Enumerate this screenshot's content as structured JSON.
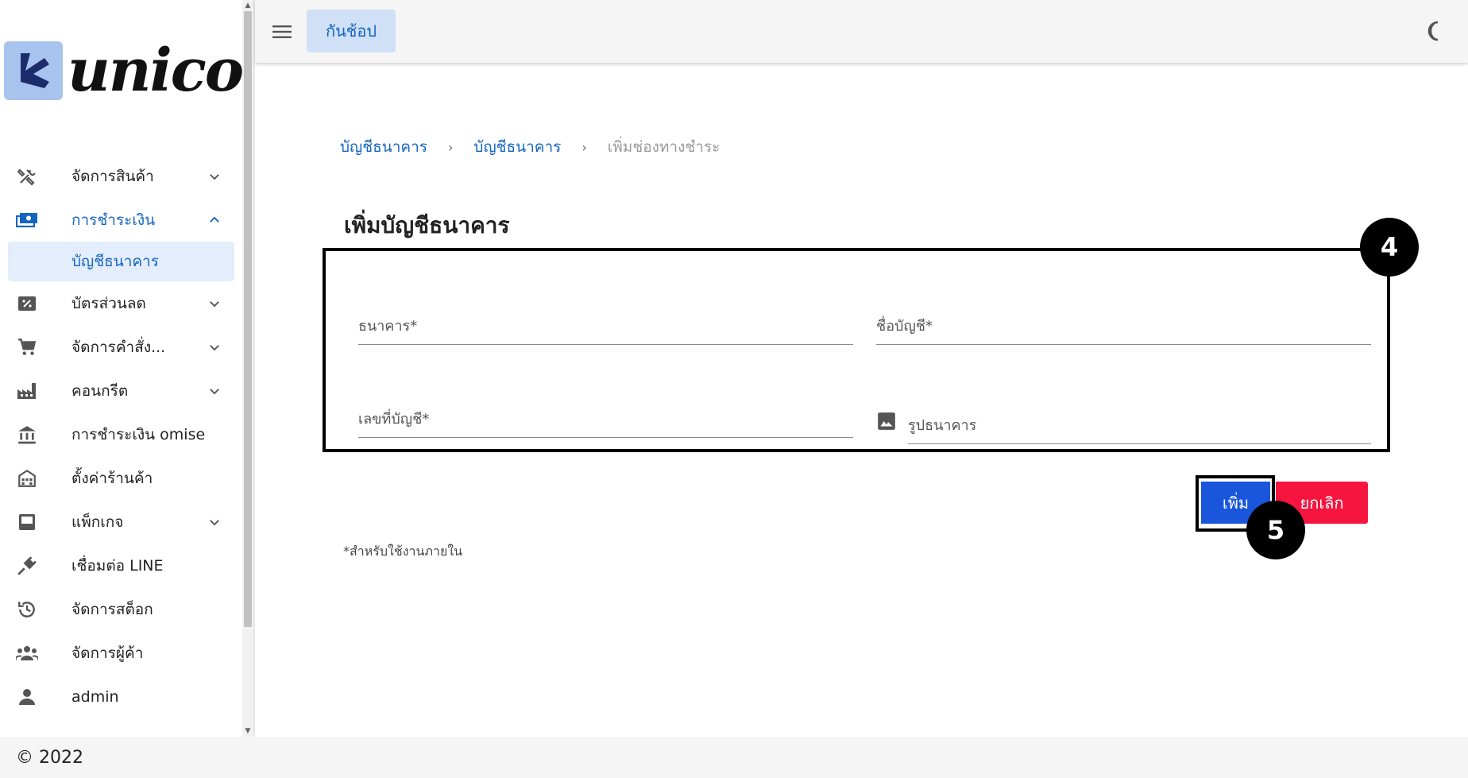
{
  "logo": {
    "text": "unicon"
  },
  "topbar": {
    "shop_label": "กันช้อป"
  },
  "sidebar": {
    "items": [
      {
        "label": "จัดการสินค้า",
        "icon": "tools-icon",
        "chevron": "down"
      },
      {
        "label": "การชำระเงิน",
        "icon": "payment-icon",
        "chevron": "up",
        "active": true
      },
      {
        "label": "บัตรส่วนลด",
        "icon": "discount-icon",
        "chevron": "down"
      },
      {
        "label": "จัดการคำสั่ง...",
        "icon": "cart-icon",
        "chevron": "down"
      },
      {
        "label": "คอนกรีต",
        "icon": "factory-icon",
        "chevron": "down"
      },
      {
        "label": "การชำระเงิน omise",
        "icon": "bank-icon"
      },
      {
        "label": "ตั้งค่าร้านค้า",
        "icon": "store-icon"
      },
      {
        "label": "แพ็กเกจ",
        "icon": "package-icon",
        "chevron": "down"
      },
      {
        "label": "เชื่อมต่อ LINE",
        "icon": "plug-icon"
      },
      {
        "label": "จัดการสต็อก",
        "icon": "history-icon"
      },
      {
        "label": "จัดการผู้ค้า",
        "icon": "group-icon"
      },
      {
        "label": "admin",
        "icon": "person-icon"
      }
    ],
    "sub_item": "บัญชีธนาคาร"
  },
  "breadcrumb": [
    "บัญชีธนาคาร",
    "บัญชีธนาคาร",
    "เพิ่มช่องทางชำระ"
  ],
  "page_title": "เพิ่มบัญชีธนาคาร",
  "form": {
    "bank_label": "ธนาคาร*",
    "account_name_label": "ชื่อบัญชี*",
    "account_number_label": "เลขที่บัญชี*",
    "bank_image_label": "รูปธนาคาร"
  },
  "buttons": {
    "add": "เพิ่ม",
    "cancel": "ยกเลิก"
  },
  "badges": {
    "form": "4",
    "add": "5"
  },
  "note": "*สำหรับใช้งานภายใน",
  "footer": "© 2022",
  "colors": {
    "primary": "#1565c0",
    "add_button": "#1a56db",
    "cancel_button": "#f5153f",
    "logo_bg": "#a9c3ef"
  }
}
